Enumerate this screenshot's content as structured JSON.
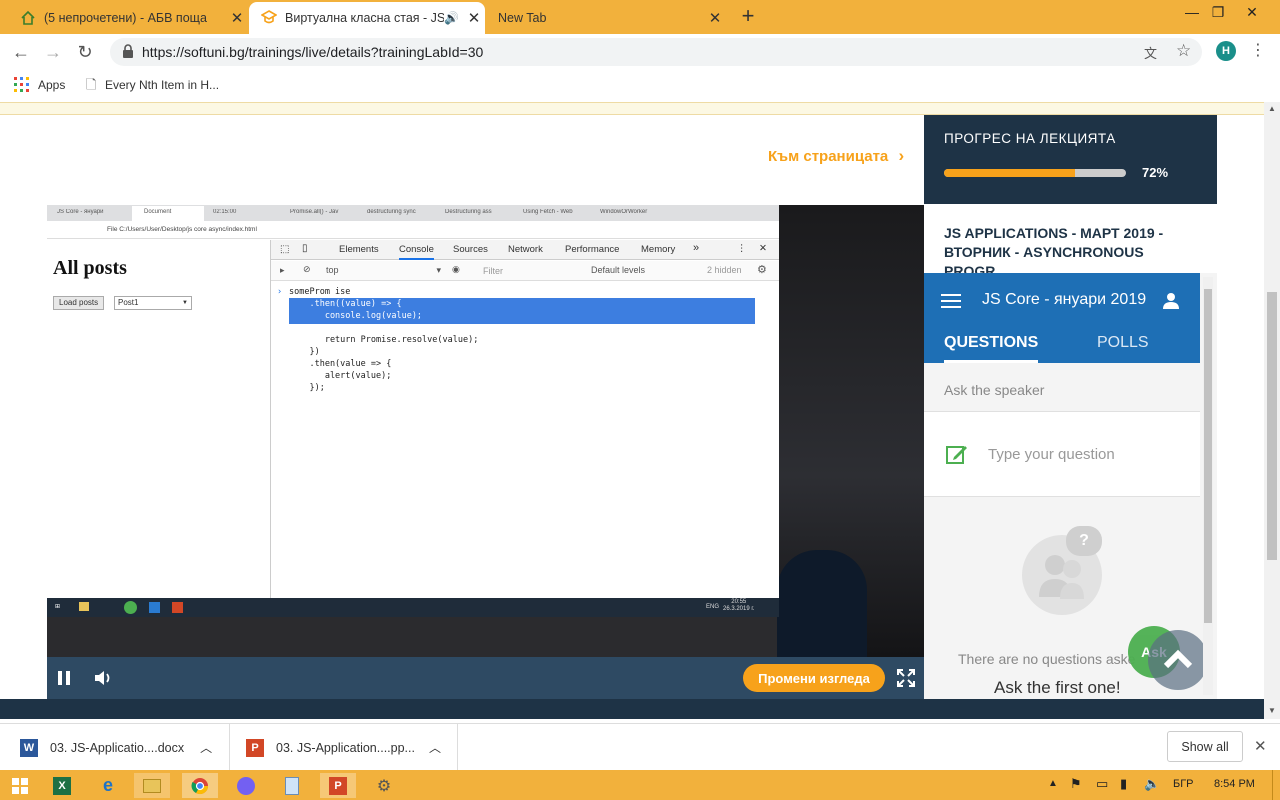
{
  "browser": {
    "tabs": [
      {
        "title": "(5 непрочетени) - АБВ поща",
        "active": false
      },
      {
        "title": "Виртуална класна стая - JS A",
        "active": true
      },
      {
        "title": "New Tab",
        "active": false
      }
    ],
    "new_tab_label": "+",
    "url": "https://softuni.bg/trainings/live/details?trainingLabId=30",
    "profile_initial": "H",
    "bookmarks": [
      {
        "label": "Apps"
      },
      {
        "label": "Every Nth Item in H..."
      }
    ]
  },
  "page": {
    "goto_page_link": "Към страницата",
    "progress": {
      "title": "ПРОГРЕС НА ЛЕКЦИЯТА",
      "percent_label": "72%",
      "percent": 72
    },
    "lecture_title": "JS APPLICATIONS - МАРТ 2019 - ВТОРНИК - ASYNCHRONOUS PROGR...",
    "video_controls": {
      "change_view_label": "Промени изгледа"
    }
  },
  "video_screen": {
    "inner_tabs": [
      "JS Core - януари",
      "Document",
      "02:15:00",
      "Promise.all() - Jav",
      "destructuring sync",
      "Destructuring ass",
      "Using Fetch - Web",
      "WindowOrWorker"
    ],
    "inner_url": "File  C:/Users/User/Desktop/js core async/index.html",
    "page_heading": "All posts",
    "load_button": "Load posts",
    "select_value": "Post1",
    "devtools_tabs": [
      "Elements",
      "Console",
      "Sources",
      "Network",
      "Performance",
      "Memory"
    ],
    "context_select": "top",
    "filter_placeholder": "Filter",
    "levels": "Default levels",
    "hidden": "2 hidden",
    "code_lines": [
      "someProm ise",
      "    .then((value) => {",
      "       console.log(value);",
      "",
      "       return Promise.resolve(value);",
      "    })",
      "    .then(value => {",
      "       alert(value);",
      "    });"
    ],
    "taskbar_lang": "ENG",
    "taskbar_time": "20:55",
    "taskbar_date": "26.3.2019 г."
  },
  "slido": {
    "event_title": "JS Core - януари 2019",
    "tabs": [
      "QUESTIONS",
      "POLLS"
    ],
    "ask_speaker": "Ask the speaker",
    "input_placeholder": "Type your question",
    "empty_text": "There are no questions aske",
    "empty_cta": "Ask the first one!",
    "ask_button": "Ask",
    "question_mark": "?"
  },
  "downloads": {
    "items": [
      {
        "name": "03. JS-Applicatio....docx"
      },
      {
        "name": "03. JS-Application....pp..."
      }
    ],
    "show_all_label": "Show all"
  },
  "taskbar": {
    "language": "БГР",
    "time": "8:54 PM"
  },
  "colors": {
    "chrome_frame": "#f2b13c",
    "accent_orange": "#f7a21b",
    "navy": "#1e3346",
    "slido_blue": "#1e6fb5",
    "ask_green": "#4caf50"
  }
}
